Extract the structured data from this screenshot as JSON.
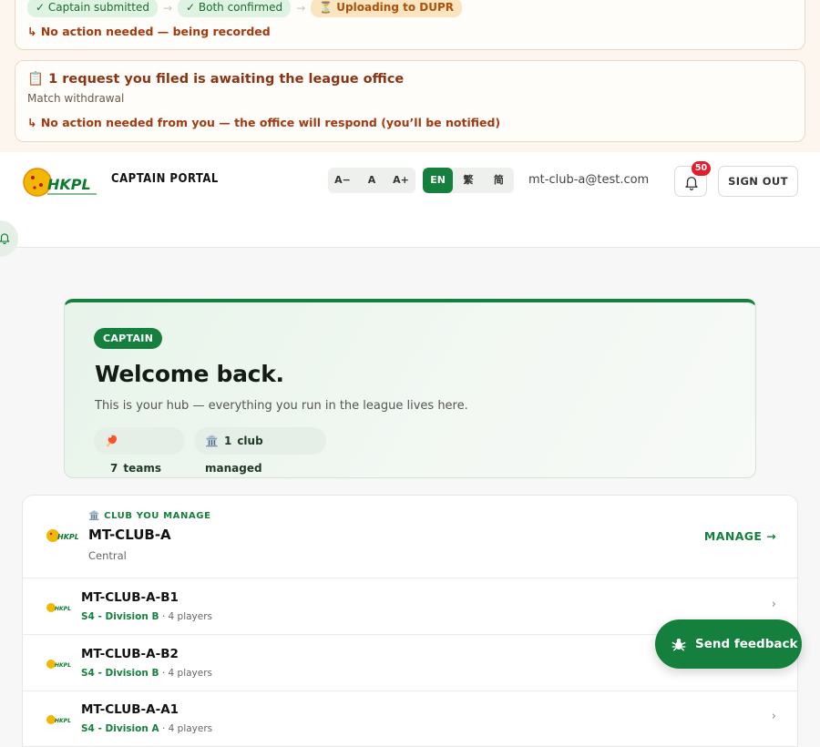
{
  "notices": {
    "progress": {
      "steps": [
        {
          "label": "✓ Captain submitted",
          "state": "done"
        },
        {
          "label": "✓ Both confirmed",
          "state": "done"
        },
        {
          "label": "⏳ Uploading to DUPR",
          "state": "pending"
        }
      ],
      "separator": "→",
      "action": "↳ No action needed — being recorded"
    },
    "request": {
      "title": "📋 1 request you filed is awaiting the league office",
      "subtitle": "Match withdrawal",
      "action": "↳ No action needed from you — the office will respond (you’ll be notified)"
    }
  },
  "header": {
    "logo_text": "HKPL",
    "title": "CAPTAIN PORTAL",
    "font_sizes": [
      "A−",
      "A",
      "A+"
    ],
    "languages": [
      {
        "label": "EN",
        "active": true
      },
      {
        "label": "繁",
        "active": false
      },
      {
        "label": "简",
        "active": false
      }
    ],
    "email": "mt-club-a@test.com",
    "notification_count": "50",
    "sign_out": "SIGN OUT"
  },
  "welcome": {
    "badge": "CAPTAIN",
    "heading": "Welcome back.",
    "subtitle": "This is your hub — everything you run in the league lives here.",
    "stats": [
      {
        "icon": "🏓",
        "count": "7",
        "label": "teams"
      },
      {
        "icon": "🏛️",
        "count": "1",
        "label": "club managed"
      }
    ]
  },
  "club": {
    "kicker": "🏛️ CLUB YOU MANAGE",
    "name": "MT-CLUB-A",
    "region": "Central",
    "manage": "MANAGE →",
    "teams": [
      {
        "name": "MT-CLUB-A-B1",
        "division": "S4 - Division B",
        "players": "· 4 players"
      },
      {
        "name": "MT-CLUB-A-B2",
        "division": "S4 - Division B",
        "players": "· 4 players"
      },
      {
        "name": "MT-CLUB-A-A1",
        "division": "S4 - Division A",
        "players": "· 4 players"
      }
    ],
    "chevron": "›"
  },
  "feedback": {
    "label": "Send feedback"
  },
  "colors": {
    "brand": "#15803d",
    "alert": "#a23a12",
    "badge": "#e11d2e"
  }
}
